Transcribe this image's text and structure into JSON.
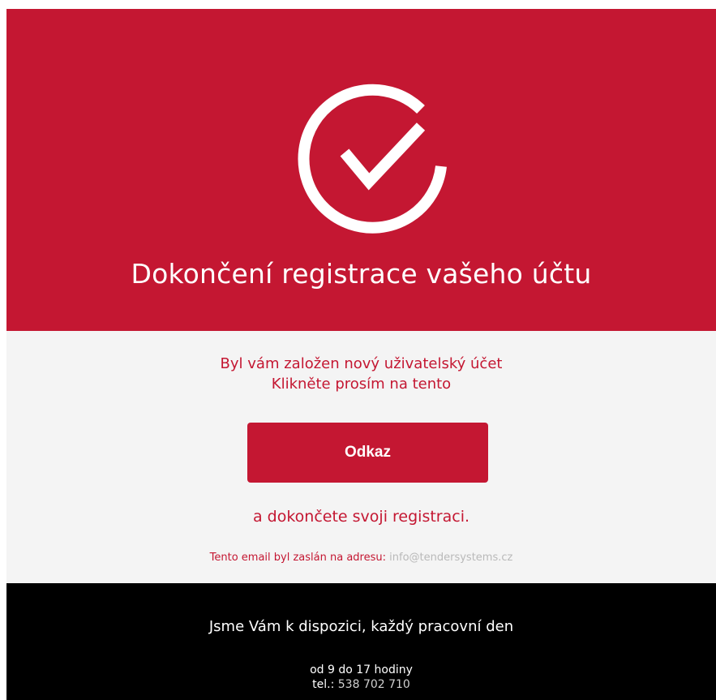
{
  "hero": {
    "icon": "check-circle-icon",
    "title": "Dokončení registrace vašeho účtu"
  },
  "content": {
    "intro_line1": "Byl vám založen nový uživatelský účet",
    "intro_line2": "Klikněte prosím na tento",
    "button_label": "Odkaz",
    "outro": "a dokončete svoji registraci.",
    "sent_label": "Tento email byl zaslán na adresu:",
    "sent_address": "info@tendersystems.cz"
  },
  "footer": {
    "lead": "Jsme Vám k dispozici, každý pracovní den",
    "hours": "od 9 do 17 hodiny",
    "phone_label": "tel.:",
    "phone_number": "538 702 710"
  },
  "colors": {
    "brand_red": "#c41732",
    "content_bg": "#f4f4f4",
    "footer_bg": "#000000",
    "muted_text": "#b9b9b9"
  }
}
